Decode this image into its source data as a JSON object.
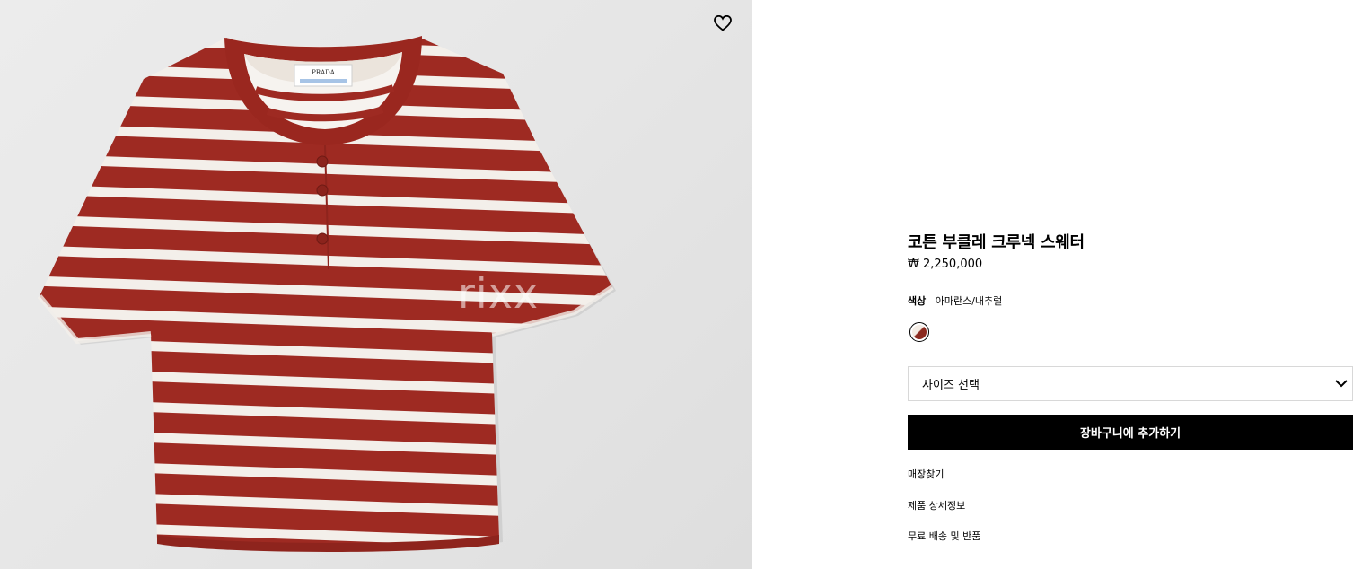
{
  "product": {
    "title": "코튼 부클레 크루넥 스웨터",
    "price": "₩ 2,250,000",
    "image_brand_label": "PRADA",
    "watermark": "rixx"
  },
  "color": {
    "label": "색상",
    "value": "아마란스/내추럴"
  },
  "size_select": {
    "placeholder": "사이즈 선택"
  },
  "actions": {
    "add_to_cart": "장바구니에 추가하기"
  },
  "links": [
    {
      "label": "매장찾기"
    },
    {
      "label": "제품 상세정보"
    },
    {
      "label": "무료 배송 및 반품"
    }
  ],
  "icons": {
    "wishlist": "heart-outline-icon",
    "dropdown": "chevron-down-icon"
  },
  "colors": {
    "stripe_red": "#9e2a22",
    "stripe_white": "#f3efea",
    "button_bg": "#000000"
  }
}
